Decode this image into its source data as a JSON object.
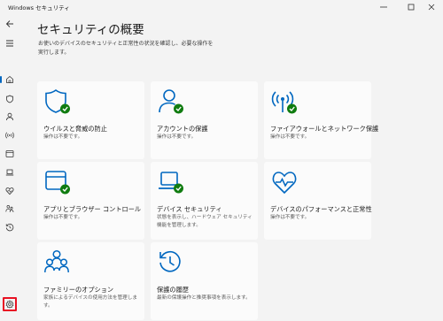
{
  "window": {
    "title": "Windows セキュリティ",
    "controls": [
      "minimize-icon",
      "maximize-icon",
      "close-icon"
    ]
  },
  "sidebar": {
    "items": [
      {
        "icon": "back-arrow-icon"
      },
      {
        "icon": "hamburger-menu-icon"
      },
      {
        "icon": "home-icon",
        "selected": true
      },
      {
        "icon": "shield-icon"
      },
      {
        "icon": "person-icon"
      },
      {
        "icon": "wifi-signal-icon"
      },
      {
        "icon": "browser-window-icon"
      },
      {
        "icon": "laptop-icon"
      },
      {
        "icon": "heart-pulse-icon"
      },
      {
        "icon": "family-icon"
      },
      {
        "icon": "history-icon"
      },
      {
        "icon": "gear-icon",
        "highlighted": true
      }
    ]
  },
  "main": {
    "title": "セキュリティの概要",
    "description": "お使いのデバイスのセキュリティと正常性の状況を確認し、必要な操作を実行します。",
    "cards": [
      {
        "title": "ウイルスと脅威の防止",
        "status": "操作は不要です。",
        "icon": "shield-check-icon"
      },
      {
        "title": "アカウントの保護",
        "status": "操作は不要です。",
        "icon": "account-check-icon"
      },
      {
        "title": "ファイアウォールとネットワーク保護",
        "status": "操作は不要です。",
        "icon": "antenna-check-icon"
      },
      {
        "title": "アプリとブラウザー コントロール",
        "status": "操作は不要です。",
        "icon": "browser-check-icon"
      },
      {
        "title": "デバイス セキュリティ",
        "status": "状態を表示し、ハードウェア セキュリティ機能を管理します。",
        "icon": "laptop-check-icon"
      },
      {
        "title": "デバイスのパフォーマンスと正常性",
        "status": "操作は不要です。",
        "icon": "heart-pulse-check-icon"
      },
      {
        "title": "ファミリーのオプション",
        "status": "家族によるデバイスの使用方法を管理します。",
        "icon": "family-icon"
      },
      {
        "title": "保護の履歴",
        "status": "最新の保護操作と推奨事項を表示します。",
        "icon": "history-clock-icon"
      }
    ]
  },
  "colors": {
    "accent": "#0067c0",
    "check_green": "#107c10",
    "highlight_red": "#e81123"
  }
}
